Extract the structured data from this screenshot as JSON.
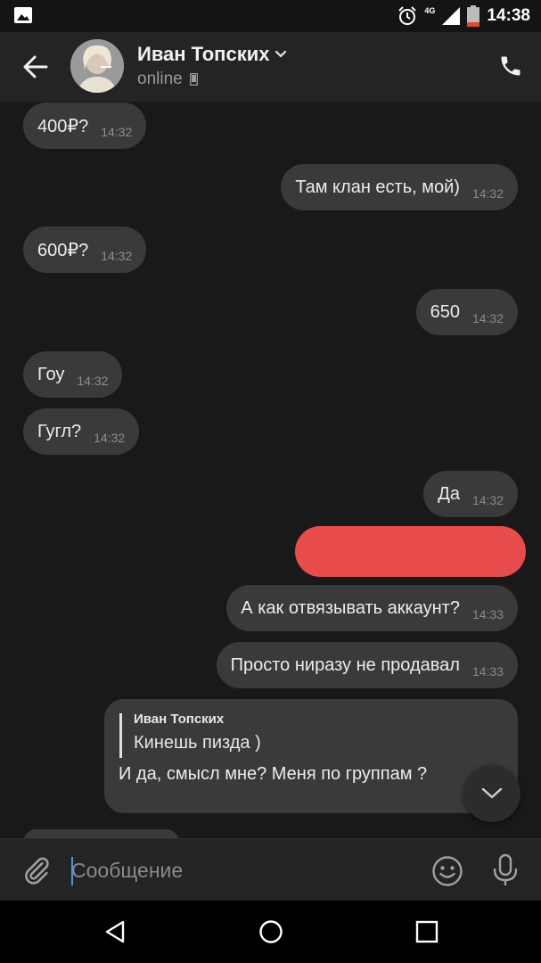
{
  "status_bar": {
    "time": "14:38",
    "network": "4G"
  },
  "header": {
    "contact_name": "Иван Топских",
    "status": "online"
  },
  "messages": [
    {
      "text": "400₽?",
      "time": "14:32",
      "direction": "in"
    },
    {
      "text": "Там клан есть, мой)",
      "time": "14:32",
      "direction": "out"
    },
    {
      "text": "600₽?",
      "time": "14:32",
      "direction": "in"
    },
    {
      "text": "650",
      "time": "14:32",
      "direction": "out"
    },
    {
      "text": "Гоу",
      "time": "14:32",
      "direction": "in"
    },
    {
      "text": "Гугл?",
      "time": "14:32",
      "direction": "in"
    },
    {
      "text": "Да",
      "time": "14:32",
      "direction": "out"
    },
    {
      "text": "А как отвязывать аккаунт?",
      "time": "14:33",
      "direction": "out"
    },
    {
      "text": "Просто ниразу не продавал",
      "time": "14:33",
      "direction": "out"
    }
  ],
  "reply_message": {
    "quote_author": "Иван Топских",
    "quote_text": "Кинешь пизда )",
    "text": "И да, смысл мне? Меня по группам ?"
  },
  "composer": {
    "placeholder": "Сообщение"
  },
  "colors": {
    "redacted": "#e84b4b",
    "bubble": "#3a3a3a",
    "background": "#191919"
  }
}
